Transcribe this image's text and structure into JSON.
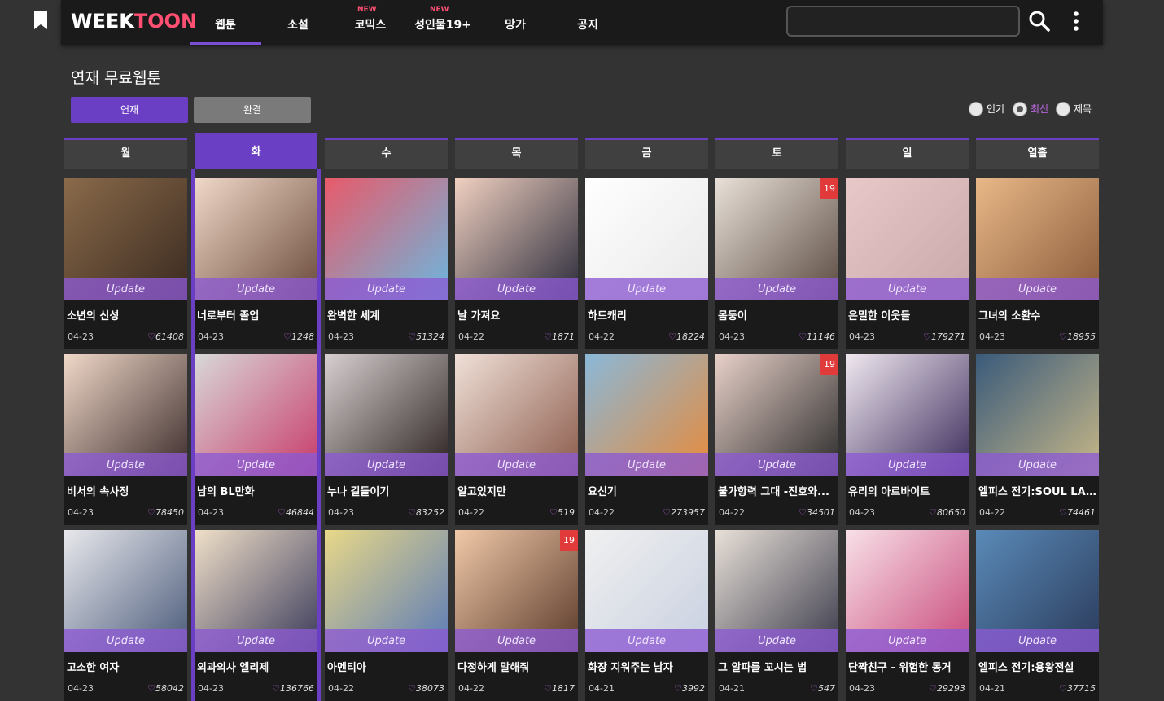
{
  "header": {
    "logo_part1": "WEEK",
    "logo_part2": "TOON",
    "search_placeholder": "",
    "nav": [
      {
        "label": "웹툰",
        "new": "",
        "active": true
      },
      {
        "label": "소설",
        "new": "",
        "active": false
      },
      {
        "label": "코믹스",
        "new": "NEW",
        "active": false
      },
      {
        "label": "성인물19+",
        "new": "NEW",
        "active": false
      },
      {
        "label": "망가",
        "new": "",
        "active": false
      },
      {
        "label": "공지",
        "new": "",
        "active": false
      }
    ]
  },
  "page_title": "연재 무료웹툰",
  "toggle": {
    "serial": "연재",
    "completed": "완결"
  },
  "sort": [
    {
      "label": "인기",
      "selected": false
    },
    {
      "label": "최신",
      "selected": true
    },
    {
      "label": "제목",
      "selected": false
    }
  ],
  "days": [
    "월",
    "화",
    "수",
    "목",
    "금",
    "토",
    "일",
    "열흘"
  ],
  "active_day_index": 1,
  "update_label": "Update",
  "colors": {
    "accent": "#6a3fc4",
    "logo_pink": "#ff4f72",
    "badge_red": "#e03a3a"
  },
  "cards": [
    {
      "title": "소년의 신성",
      "date": "04-23",
      "likes": "61408",
      "badge": "",
      "c1": "#8a6a4a",
      "c2": "#3a2a20"
    },
    {
      "title": "너로부터 졸업",
      "date": "04-23",
      "likes": "1248",
      "badge": "",
      "c1": "#f0d8c8",
      "c2": "#6a4a3a"
    },
    {
      "title": "완벽한 세계",
      "date": "04-23",
      "likes": "51324",
      "badge": "",
      "c1": "#e85a6a",
      "c2": "#6ab8e0"
    },
    {
      "title": "날 가져요",
      "date": "04-22",
      "likes": "1871",
      "badge": "",
      "c1": "#f0d0c0",
      "c2": "#2a2a3a"
    },
    {
      "title": "하드캐리",
      "date": "04-22",
      "likes": "18224",
      "badge": "",
      "c1": "#ffffff",
      "c2": "#e8e8e8"
    },
    {
      "title": "몸둥이",
      "date": "04-23",
      "likes": "11146",
      "badge": "19",
      "c1": "#e8e0d8",
      "c2": "#5a4a40"
    },
    {
      "title": "은밀한 이웃들",
      "date": "04-23",
      "likes": "179271",
      "badge": "",
      "c1": "#e8c8c8",
      "c2": "#c8a8a8"
    },
    {
      "title": "그녀의 소환수",
      "date": "04-23",
      "likes": "18955",
      "badge": "",
      "c1": "#e8b888",
      "c2": "#8a5a3a"
    },
    {
      "title": "비서의 속사정",
      "date": "04-23",
      "likes": "78450",
      "badge": "",
      "c1": "#f0d8c8",
      "c2": "#3a2a2a"
    },
    {
      "title": "남의 BL만화",
      "date": "04-23",
      "likes": "46844",
      "badge": "",
      "c1": "#d8d8d8",
      "c2": "#c83a6a"
    },
    {
      "title": "누나 길들이기",
      "date": "04-23",
      "likes": "83252",
      "badge": "",
      "c1": "#d8d0d0",
      "c2": "#2a2020"
    },
    {
      "title": "알고있지만",
      "date": "04-22",
      "likes": "519",
      "badge": "",
      "c1": "#f0e0d8",
      "c2": "#8a5a4a"
    },
    {
      "title": "요신기",
      "date": "04-22",
      "likes": "273957",
      "badge": "",
      "c1": "#8ab8d8",
      "c2": "#e88a3a"
    },
    {
      "title": "불가항력 그대 -진호와...",
      "date": "04-22",
      "likes": "34501",
      "badge": "19",
      "c1": "#e8d0c8",
      "c2": "#2a2a2a"
    },
    {
      "title": "유리의 아르바이트",
      "date": "04-23",
      "likes": "80650",
      "badge": "",
      "c1": "#f0e8f0",
      "c2": "#3a2a5a"
    },
    {
      "title": "엘피스 전기:SOUL LA...",
      "date": "04-22",
      "likes": "74461",
      "badge": "",
      "c1": "#3a5a7a",
      "c2": "#c8b888"
    },
    {
      "title": "고소한 여자",
      "date": "04-23",
      "likes": "58042",
      "badge": "",
      "c1": "#e8e8ec",
      "c2": "#4a5a7a"
    },
    {
      "title": "외과의사 엘리제",
      "date": "04-23",
      "likes": "136766",
      "badge": "",
      "c1": "#f0e0c8",
      "c2": "#3a3a5a"
    },
    {
      "title": "아멘티아",
      "date": "04-22",
      "likes": "38073",
      "badge": "",
      "c1": "#e8d888",
      "c2": "#5a7ab8"
    },
    {
      "title": "다정하게 말해줘",
      "date": "04-22",
      "likes": "1817",
      "badge": "19",
      "c1": "#f0c8a8",
      "c2": "#5a3a2a"
    },
    {
      "title": "화장 지워주는 남자",
      "date": "04-21",
      "likes": "3992",
      "badge": "",
      "c1": "#f0f0f0",
      "c2": "#c8d0e0"
    },
    {
      "title": "그 알파를 꼬시는 법",
      "date": "04-21",
      "likes": "547",
      "badge": "",
      "c1": "#e8e0d8",
      "c2": "#3a3a4a"
    },
    {
      "title": "단짝친구 - 위험한 동거",
      "date": "04-23",
      "likes": "29293",
      "badge": "",
      "c1": "#f8e0e8",
      "c2": "#c84a7a"
    },
    {
      "title": "엘피스 전기:용왕전설",
      "date": "04-21",
      "likes": "37715",
      "badge": "",
      "c1": "#5a8ab8",
      "c2": "#2a3a5a"
    }
  ]
}
